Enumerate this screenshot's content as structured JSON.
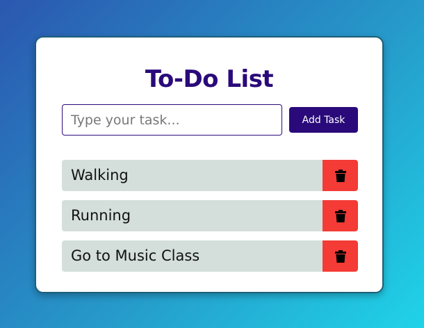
{
  "app": {
    "title": "To-Do List"
  },
  "input": {
    "placeholder": "Type your task...",
    "value": ""
  },
  "add_button": {
    "label": "Add Task"
  },
  "tasks": [
    {
      "label": "Walking",
      "delete_icon": "trash-icon"
    },
    {
      "label": "Running",
      "delete_icon": "trash-icon"
    },
    {
      "label": "Go to Music Class",
      "delete_icon": "trash-icon"
    }
  ],
  "colors": {
    "accent": "#2a0a7a",
    "task_background": "#d4dfdc",
    "delete": "#f43b35",
    "card": "#ffffff"
  }
}
